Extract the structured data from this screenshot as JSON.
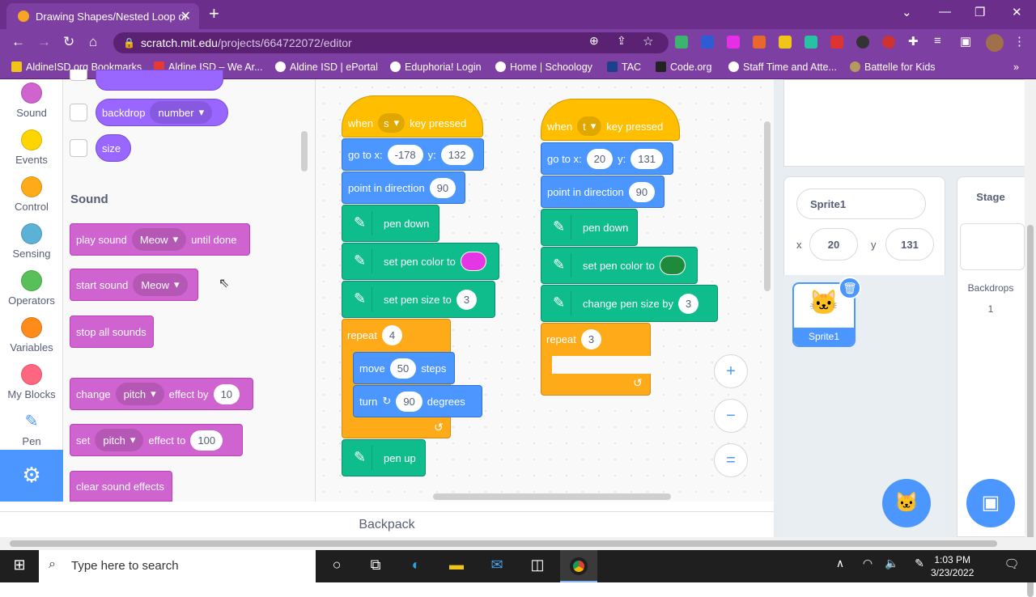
{
  "browser": {
    "tab_title": "Drawing Shapes/Nested Loop or",
    "url_host": "scratch.mit.edu",
    "url_path": "/projects/664722072/editor",
    "bookmarks": [
      "AldineISD.org Bookmarks",
      "Aldine ISD – We Ar...",
      "Aldine ISD | ePortal",
      "Eduphoria! Login",
      "Home | Schoology",
      "TAC",
      "Code.org",
      "Staff Time and Atte...",
      "Battelle for Kids"
    ]
  },
  "categories": [
    {
      "label": "Sound",
      "color": "#cf63cf"
    },
    {
      "label": "Events",
      "color": "#ffd500"
    },
    {
      "label": "Control",
      "color": "#ffab19"
    },
    {
      "label": "Sensing",
      "color": "#5cb1d6"
    },
    {
      "label": "Operators",
      "color": "#59c059"
    },
    {
      "label": "Variables",
      "color": "#ff8c1a"
    },
    {
      "label": "My Blocks",
      "color": "#ff6680"
    },
    {
      "label": "Pen",
      "color": "#0fbd8c"
    }
  ],
  "palette": {
    "looks": {
      "backdrop": "backdrop",
      "backdrop_dd": "number",
      "size": "size"
    },
    "sound_header": "Sound",
    "play": {
      "a": "play sound",
      "dd": "Meow",
      "b": "until done"
    },
    "start": {
      "a": "start sound",
      "dd": "Meow"
    },
    "stop": "stop all sounds",
    "change": {
      "a": "change",
      "dd": "pitch",
      "b": "effect by",
      "v": "10"
    },
    "set": {
      "a": "set",
      "dd": "pitch",
      "b": "effect to",
      "v": "100"
    },
    "clear": "clear sound effects"
  },
  "script1": {
    "when": "when",
    "key": "s",
    "pressed": "key pressed",
    "goto": "go to x:",
    "x": "-178",
    "y_label": "y:",
    "y": "132",
    "point": "point in direction",
    "dir": "90",
    "pendown": "pen down",
    "setcolor": "set pen color to",
    "color": "#e536e5",
    "setsize": "set pen size to",
    "size": "3",
    "repeat": "repeat",
    "times": "4",
    "move": "move",
    "steps_v": "50",
    "steps": "steps",
    "turn": "turn",
    "deg_v": "90",
    "degrees": "degrees",
    "penup": "pen up"
  },
  "script2": {
    "when": "when",
    "key": "t",
    "pressed": "key pressed",
    "goto": "go to x:",
    "x": "20",
    "y_label": "y:",
    "y": "131",
    "point": "point in direction",
    "dir": "90",
    "pendown": "pen down",
    "setcolor": "set pen color to",
    "color": "#1e8a3a",
    "changesize": "change pen size by",
    "size": "3",
    "repeat": "repeat",
    "times": "3"
  },
  "backpack": "Backpack",
  "sprite": {
    "name": "Sprite1",
    "x_label": "x",
    "x": "20",
    "y_label": "y",
    "y": "131",
    "thumb_label": "Sprite1"
  },
  "stage": {
    "label": "Stage",
    "backdrops_label": "Backdrops",
    "backdrops": "1"
  },
  "taskbar": {
    "search": "Type here to search",
    "time": "1:03 PM",
    "date": "3/23/2022"
  }
}
